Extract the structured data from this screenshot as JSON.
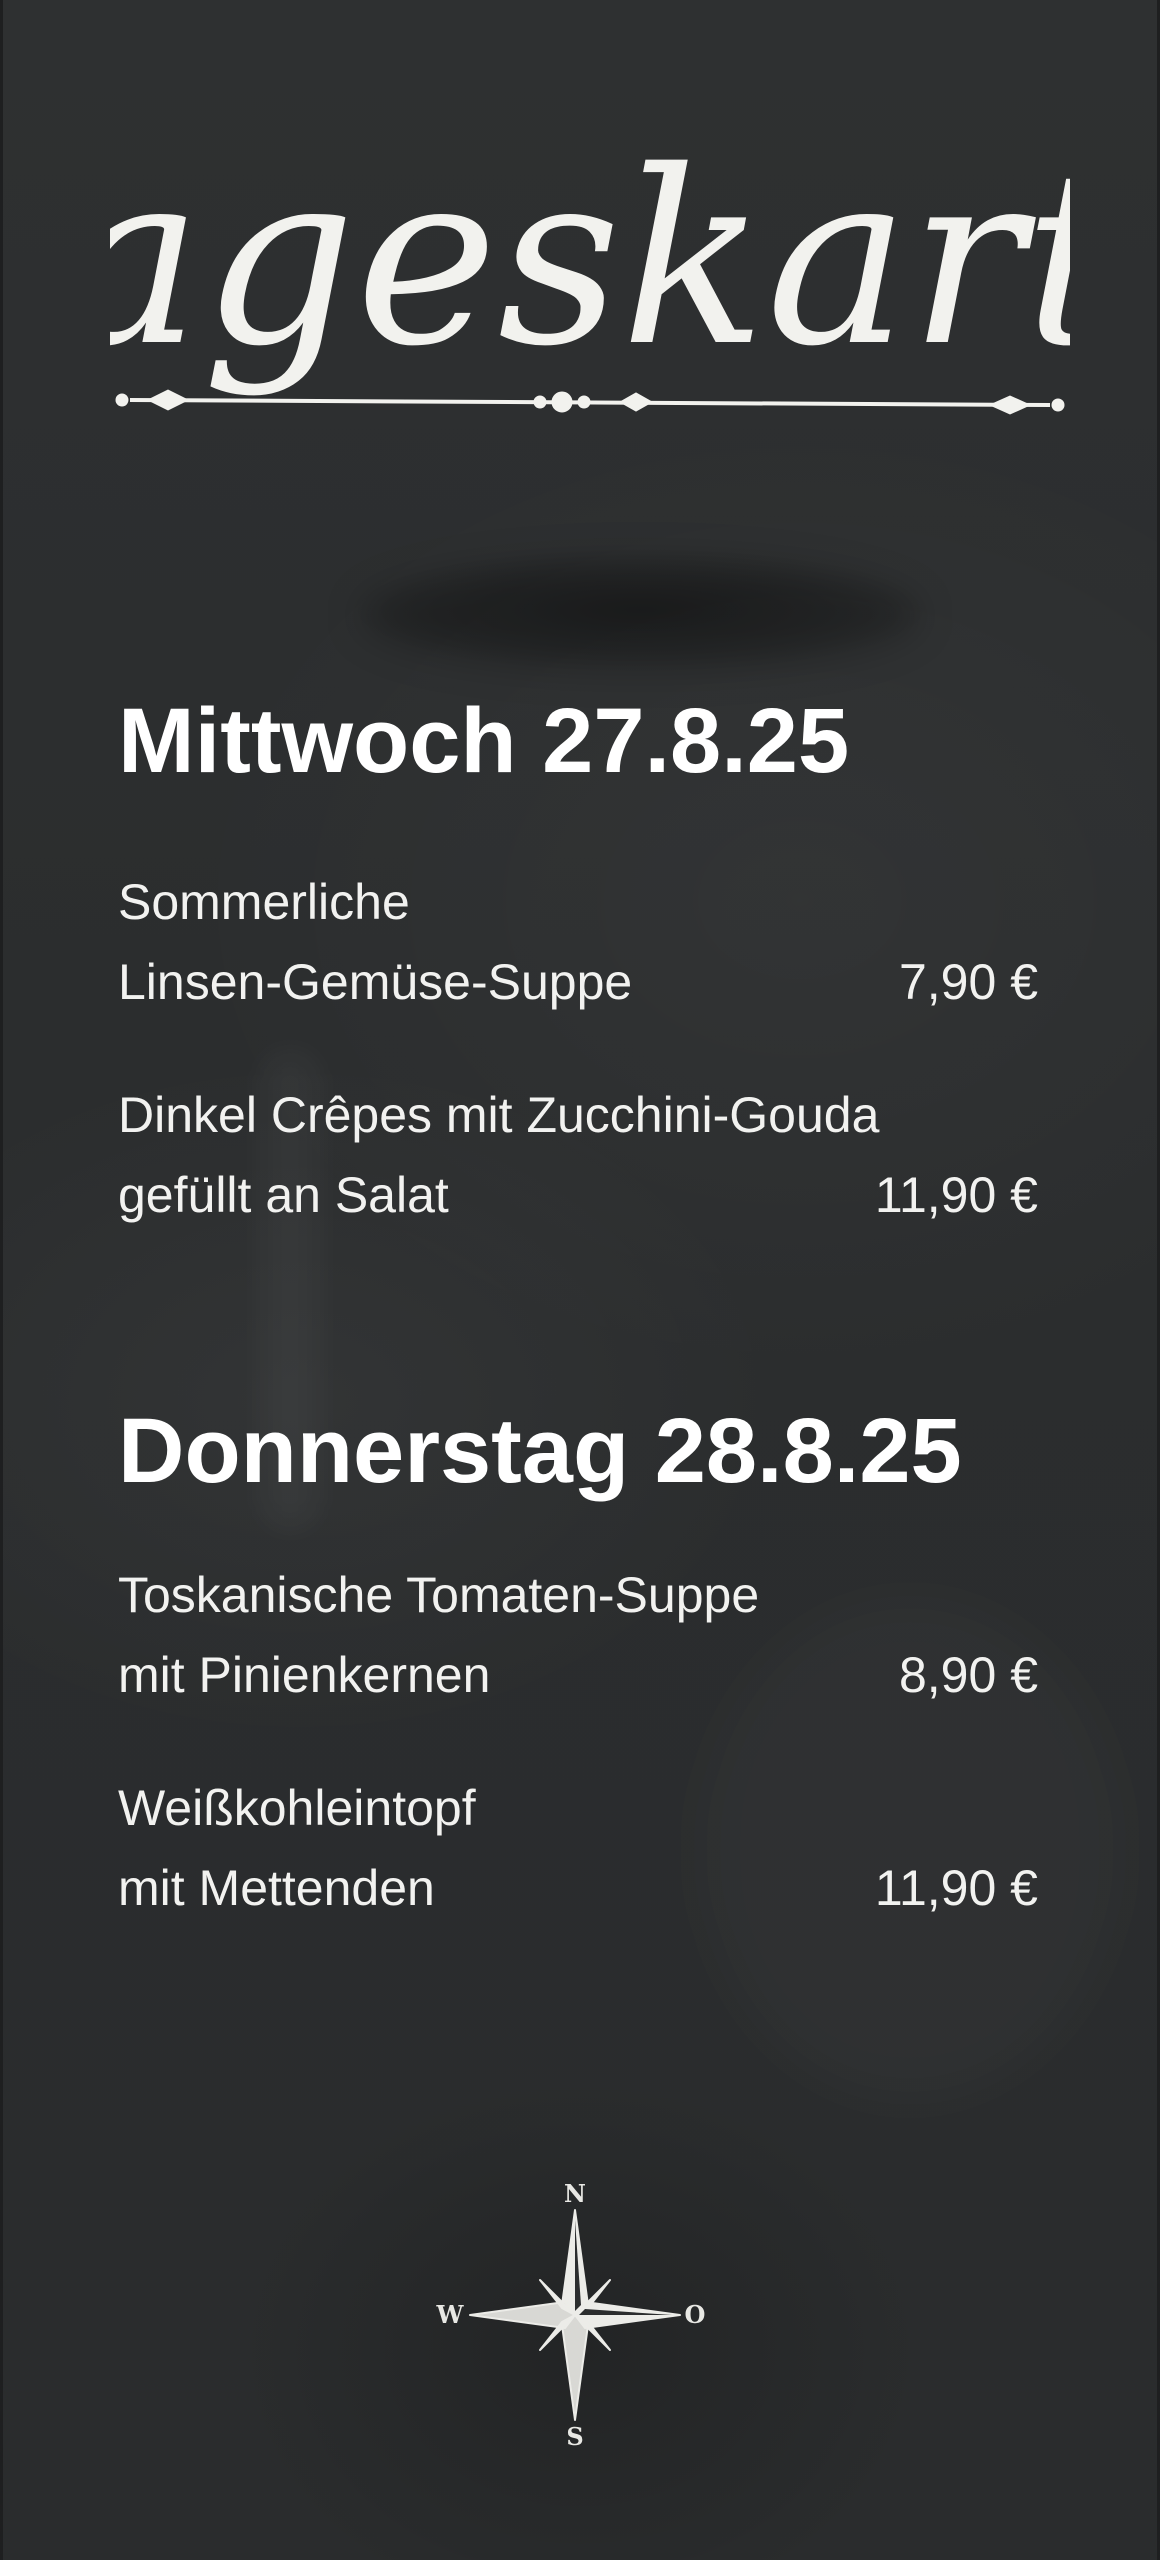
{
  "header": {
    "title": "Tageskarte"
  },
  "days": [
    {
      "heading": "Mittwoch 27.8.25",
      "dishes": [
        {
          "line1": "Sommerliche",
          "line2": "Linsen-Gemüse-Suppe",
          "price": "7,90 €"
        },
        {
          "line1": "Dinkel Crêpes mit Zucchini-Gouda",
          "line2": "gefüllt an Salat",
          "price": "11,90 €"
        }
      ]
    },
    {
      "heading": "Donnerstag 28.8.25",
      "dishes": [
        {
          "line1": "Toskanische Tomaten-Suppe",
          "line2": "mit Pinienkernen",
          "price": "8,90 €"
        },
        {
          "line1": "Weißkohleintopf",
          "line2": "mit Mettenden",
          "price": "11,90 €"
        }
      ]
    }
  ],
  "compass": {
    "north": "N",
    "east": "O",
    "south": "S",
    "west": "W"
  },
  "colors": {
    "board": "#2b2d2e",
    "chalk": "#f2f2ee"
  }
}
